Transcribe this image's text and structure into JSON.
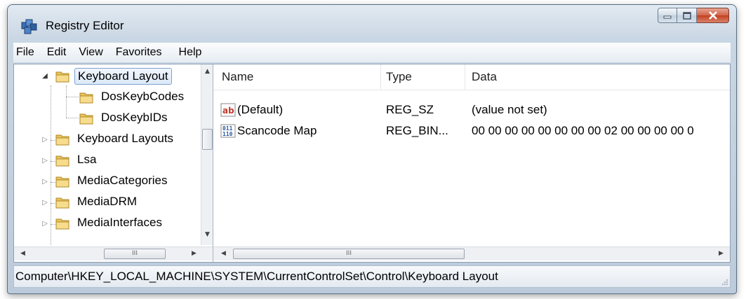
{
  "window": {
    "title": "Registry Editor",
    "app_icon": "registry-editor-icon",
    "controls": {
      "minimize": "minimize-icon",
      "maximize": "maximize-icon",
      "close": "close-icon"
    }
  },
  "menu": [
    "File",
    "Edit",
    "View",
    "Favorites",
    "Help"
  ],
  "tree": {
    "items": [
      {
        "label": "Keyboard Layout",
        "expanded": true,
        "selected": true
      },
      {
        "label": "DosKeybCodes",
        "child": true
      },
      {
        "label": "DosKeybIDs",
        "child": true
      },
      {
        "label": "Keyboard Layouts",
        "expanded": false
      },
      {
        "label": "Lsa",
        "expanded": false
      },
      {
        "label": "MediaCategories",
        "expanded": false
      },
      {
        "label": "MediaDRM",
        "expanded": false
      },
      {
        "label": "MediaInterfaces",
        "expanded": false
      }
    ],
    "hscroll_grip": "III"
  },
  "list": {
    "columns": [
      "Name",
      "Type",
      "Data"
    ],
    "rows": [
      {
        "icon": "string-value-icon",
        "name": "(Default)",
        "type": "REG_SZ",
        "data": "(value not set)"
      },
      {
        "icon": "binary-value-icon",
        "name": "Scancode Map",
        "type": "REG_BIN...",
        "data": "00 00 00 00 00 00 00 00 02 00 00 00 00 0"
      }
    ],
    "hscroll_grip": "III"
  },
  "status": {
    "path": "Computer\\HKEY_LOCAL_MACHINE\\SYSTEM\\CurrentControlSet\\Control\\Keyboard Layout"
  },
  "colors": {
    "title_gradient": "#c9d6e3",
    "selection_border": "#7da2ce",
    "folder": "#e8c35a",
    "close_button": "#c3411f"
  }
}
